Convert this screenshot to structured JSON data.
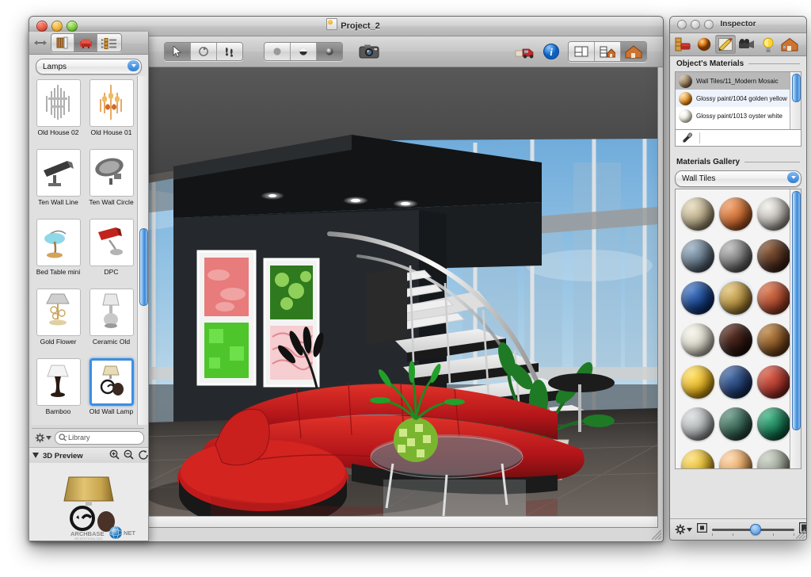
{
  "app": {
    "main_window_title": "Project_2",
    "inspector_window_title": "Inspector"
  },
  "main_toolbar": {
    "tools": [
      {
        "name": "arrow-select-tool",
        "icon": "arrow-icon",
        "active": true
      },
      {
        "name": "rotate-tool",
        "icon": "rotate-icon",
        "active": false
      },
      {
        "name": "walk-tool",
        "icon": "footsteps-icon",
        "active": false
      }
    ],
    "render_modes": [
      {
        "name": "flat-shading",
        "icon": "flat-sphere-icon",
        "active": false
      },
      {
        "name": "smooth-shading",
        "icon": "half-sphere-icon",
        "active": false
      },
      {
        "name": "textured-shading",
        "icon": "shaded-sphere-icon",
        "active": true
      }
    ],
    "camera_label": "camera-icon",
    "right_tools": [
      {
        "name": "render-truck",
        "icon": "truck-icon"
      },
      {
        "name": "info",
        "icon": "info-icon"
      }
    ],
    "view_modes": [
      {
        "name": "plan-view",
        "icon": "plan-icon",
        "active": false
      },
      {
        "name": "split-view",
        "icon": "split-house-icon",
        "active": false
      },
      {
        "name": "house-view",
        "icon": "house-icon",
        "active": true
      }
    ]
  },
  "library": {
    "toolbar": {
      "resize_handle": "resize-icon",
      "buttons": [
        {
          "name": "catalog-button",
          "icon": "bookshelf-icon",
          "active": false
        },
        {
          "name": "furniture-button",
          "icon": "armchair-icon",
          "active": true
        },
        {
          "name": "list-button",
          "icon": "list-icon",
          "active": false
        }
      ]
    },
    "category": "Lamps",
    "items": [
      {
        "label": "Old House 02",
        "selected": false
      },
      {
        "label": "Old House 01",
        "selected": false
      },
      {
        "label": "Ten Wall Line",
        "selected": false
      },
      {
        "label": "Ten Wall Circle",
        "selected": false
      },
      {
        "label": "Bed Table mini",
        "selected": false
      },
      {
        "label": "DPC",
        "selected": false
      },
      {
        "label": "Gold Flower",
        "selected": false
      },
      {
        "label": "Ceramic Old",
        "selected": false
      },
      {
        "label": "Bamboo",
        "selected": false
      },
      {
        "label": "Old Wall Lamp",
        "selected": true
      }
    ],
    "action_menu": "gear-icon",
    "search_placeholder": "Library",
    "search_value": "",
    "preview": {
      "title": "3D Preview",
      "zoom_in": "zoom-in-icon",
      "zoom_out": "zoom-out-icon",
      "rotate": "rotate-icon",
      "watermark_primary": "ARCHBASE",
      "watermark_secondary": "NET",
      "watermark_sub": "ARCHITECTURAL DATA"
    }
  },
  "inspector": {
    "toolbar": [
      {
        "name": "objects-tab",
        "icon": "furniture-icon",
        "active": false
      },
      {
        "name": "materials-tab",
        "icon": "material-sphere-icon",
        "active": false
      },
      {
        "name": "edit-tab",
        "icon": "pencil-ruler-icon",
        "active": true
      },
      {
        "name": "camera-tab",
        "icon": "video-camera-icon",
        "active": false
      },
      {
        "name": "lights-tab",
        "icon": "lightbulb-icon",
        "active": false
      },
      {
        "name": "building-tab",
        "icon": "house-icon",
        "active": false
      }
    ],
    "objects_materials": {
      "title": "Object's Materials",
      "rows": [
        {
          "label": "Wall Tiles/11_Modern Mosaic",
          "color": "#8a7156",
          "state": "selected"
        },
        {
          "label": "Glossy paint/1004 golden yellow",
          "color": "#e08a18",
          "state": "alt"
        },
        {
          "label": "Glossy paint/1013 oyster white",
          "color": "#efeade",
          "state": "normal"
        }
      ],
      "eyedropper": "eyedropper-icon",
      "eyedropper_value": ""
    },
    "materials_gallery": {
      "title": "Materials Gallery",
      "category": "Wall Tiles",
      "swatches": [
        {
          "color": "#b3a582",
          "selected": false
        },
        {
          "color": "#c4642a",
          "selected": false
        },
        {
          "color": "#b9b5ae",
          "selected": false
        },
        {
          "color": "#5c6c7c",
          "selected": false
        },
        {
          "color": "#707070",
          "selected": false
        },
        {
          "color": "#4a2c1c",
          "selected": false
        },
        {
          "color": "#123a7e",
          "selected": false
        },
        {
          "color": "#b08a3a",
          "selected": true
        },
        {
          "color": "#a8452a",
          "selected": false
        },
        {
          "color": "#d7d4c6",
          "selected": false
        },
        {
          "color": "#2c1510",
          "selected": false
        },
        {
          "color": "#7a4a1e",
          "selected": false
        },
        {
          "color": "#e3b01c",
          "selected": false
        },
        {
          "color": "#1e3a6e",
          "selected": false
        },
        {
          "color": "#a8322a",
          "selected": false
        },
        {
          "color": "#adb1b2",
          "selected": false
        },
        {
          "color": "#2f5a4c",
          "selected": false
        },
        {
          "color": "#13714f",
          "selected": false
        },
        {
          "color": "#e0b424",
          "selected": false
        },
        {
          "color": "#e8a45c",
          "selected": false
        },
        {
          "color": "#9aa394",
          "selected": false
        }
      ]
    },
    "bottom_bar": {
      "action_menu": "gear-icon",
      "small_thumb_icon": "small-thumbnail-icon",
      "large_thumb_icon": "large-thumbnail-icon",
      "slider_value": 52
    }
  },
  "scene": {
    "description": "3D rendered modern living room interior with red sectional sofa, glass coffee table, spiral staircase, floor-to-ceiling glass windows, framed wall art, plants and recessed ceiling lights",
    "colors": {
      "sky": "#7fb6e0",
      "sofa": "#b3161a",
      "ceiling": "#4e4e4e",
      "dark_wall": "#23272b",
      "floor": "#4b4744"
    }
  }
}
